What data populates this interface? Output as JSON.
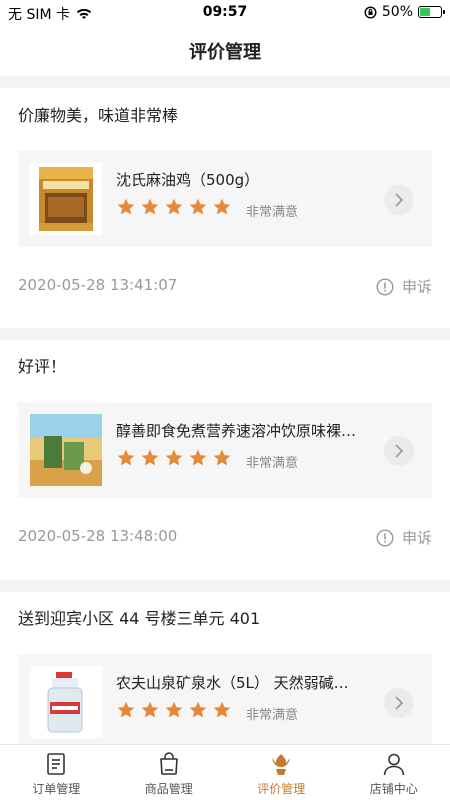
{
  "status_bar": {
    "carrier": "无 SIM 卡",
    "time": "09:57",
    "battery": "50%",
    "battery_level": 0.5
  },
  "header": {
    "title": "评价管理"
  },
  "reviews": [
    {
      "comment": "价廉物美，味道非常棒",
      "product_name": "沈氏麻油鸡（500g）",
      "stars": 5,
      "rating_text": "非常满意",
      "datetime": "2020-05-28 13:41:07",
      "complain_label": "申诉"
    },
    {
      "comment": "好评！",
      "product_name": "醇善即食免煮营养速溶冲饮原味裸…",
      "stars": 5,
      "rating_text": "非常满意",
      "datetime": "2020-05-28 13:48:00",
      "complain_label": "申诉"
    },
    {
      "comment": "送到迎宾小区 44 号楼三单元 401",
      "product_name": "农夫山泉矿泉水（5L） 天然弱碱…",
      "stars": 5,
      "rating_text": "非常满意"
    }
  ],
  "tabbar": {
    "items": [
      {
        "label": "订单管理",
        "icon": "order-icon"
      },
      {
        "label": "商品管理",
        "icon": "bag-icon"
      },
      {
        "label": "评价管理",
        "icon": "flower-icon",
        "active": true
      },
      {
        "label": "店铺中心",
        "icon": "person-icon"
      }
    ]
  },
  "colors": {
    "accent": "#c47a2c",
    "star": "#e8883a",
    "background": "#f4f4f4"
  }
}
